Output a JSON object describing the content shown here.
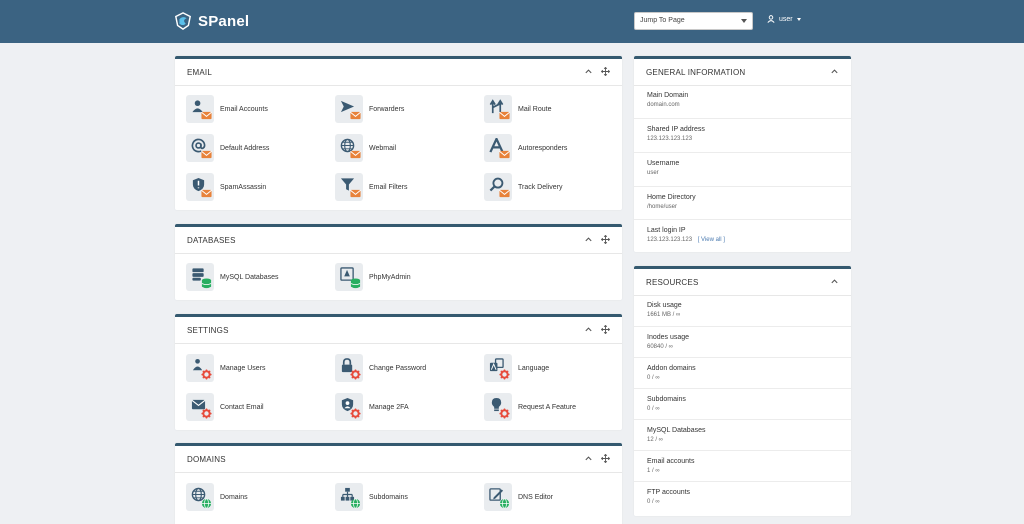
{
  "app": {
    "name": "SPanel",
    "jump_to_page": "Jump To Page",
    "user": "user"
  },
  "colors": {
    "topbar": "#3b6382",
    "panel_border": "#34596f",
    "accent_mail": "#e8823a",
    "accent_db": "#27ae60",
    "accent_settings": "#e74c3c",
    "accent_domain": "#27ae60"
  },
  "email": {
    "title": "EMAIL",
    "items": [
      {
        "label": "Email Accounts",
        "icon": "user-icon"
      },
      {
        "label": "Forwarders",
        "icon": "forward-arrow-icon"
      },
      {
        "label": "Mail Route",
        "icon": "route-arrows-icon"
      },
      {
        "label": "Default Address",
        "icon": "at-sign-icon"
      },
      {
        "label": "Webmail",
        "icon": "globe-icon"
      },
      {
        "label": "Autoresponders",
        "icon": "letter-a-icon"
      },
      {
        "label": "SpamAssassin",
        "icon": "shield-icon"
      },
      {
        "label": "Email Filters",
        "icon": "funnel-icon"
      },
      {
        "label": "Track Delivery",
        "icon": "magnifier-icon"
      }
    ]
  },
  "databases": {
    "title": "DATABASES",
    "items": [
      {
        "label": "MySQL Databases",
        "icon": "database-icon"
      },
      {
        "label": "PhpMyAdmin",
        "icon": "phpmyadmin-icon"
      }
    ]
  },
  "settings": {
    "title": "SETTINGS",
    "items": [
      {
        "label": "Manage Users",
        "icon": "users-icon"
      },
      {
        "label": "Change Password",
        "icon": "lock-icon"
      },
      {
        "label": "Language",
        "icon": "language-icon"
      },
      {
        "label": "Contact Email",
        "icon": "envelope-icon"
      },
      {
        "label": "Manage 2FA",
        "icon": "user-shield-icon"
      },
      {
        "label": "Request A Feature",
        "icon": "lightbulb-icon"
      }
    ]
  },
  "domains": {
    "title": "DOMAINS",
    "items": [
      {
        "label": "Domains",
        "icon": "globe-icon"
      },
      {
        "label": "Subdomains",
        "icon": "sitemap-icon"
      },
      {
        "label": "DNS Editor",
        "icon": "edit-icon"
      }
    ]
  },
  "general": {
    "title": "GENERAL INFORMATION",
    "rows": [
      {
        "label": "Main Domain",
        "value": "domain.com"
      },
      {
        "label": "Shared IP address",
        "value": "123.123.123.123"
      },
      {
        "label": "Username",
        "value": "user"
      },
      {
        "label": "Home Directory",
        "value": "/home/user"
      },
      {
        "label": "Last login IP",
        "value": "123.123.123.123",
        "link": "[ View all ]"
      }
    ]
  },
  "resources": {
    "title": "RESOURCES",
    "rows": [
      {
        "label": "Disk usage",
        "value": "1661 MB / ∞"
      },
      {
        "label": "Inodes usage",
        "value": "60840 / ∞"
      },
      {
        "label": "Addon domains",
        "value": "0 / ∞"
      },
      {
        "label": "Subdomains",
        "value": "0 / ∞"
      },
      {
        "label": "MySQL Databases",
        "value": "12 / ∞"
      },
      {
        "label": "Email accounts",
        "value": "1 / ∞"
      },
      {
        "label": "FTP accounts",
        "value": "0 / ∞"
      }
    ]
  }
}
